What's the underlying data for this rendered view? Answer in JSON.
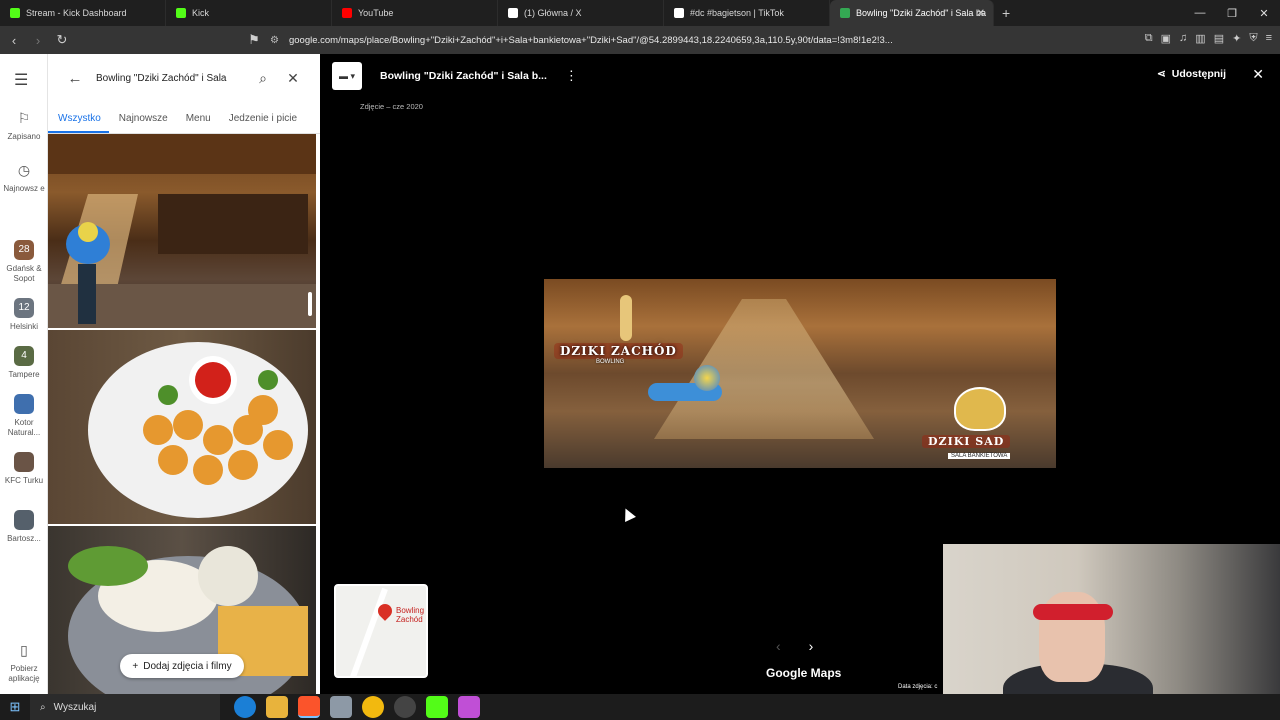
{
  "browser": {
    "tabs": [
      {
        "label": "Stream - Kick Dashboard",
        "color": "#53fc18"
      },
      {
        "label": "Kick",
        "color": "#53fc18"
      },
      {
        "label": "YouTube",
        "color": "#ff0000"
      },
      {
        "label": "(1) Główna / X",
        "color": "#ffffff"
      },
      {
        "label": "#dc #bagietson | TikTok",
        "color": "#ffffff"
      },
      {
        "label": "Bowling \"Dziki Zachód\" i Sala ba",
        "color": "#34a853"
      }
    ],
    "url": "google.com/maps/place/Bowling+\"Dziki+Zachód\"+i+Sala+bankietowa+\"Dziki+Sad\"/@54.2899443,18.2240659,3a,110.5y,90t/data=!3m8!1e2!3...",
    "new_tab": "+",
    "win_minimize": "—",
    "win_restore": "❐",
    "win_close": "✕"
  },
  "rail": {
    "menu_icon": "☰",
    "saved": "Zapisano",
    "recent": "Najnowsz e",
    "items": [
      {
        "label": "Gdańsk & Sopot",
        "badge": "28",
        "color": "#8a5a3c"
      },
      {
        "label": "Helsinki",
        "badge": "12",
        "color": "#6c7580"
      },
      {
        "label": "Tampere",
        "badge": "4",
        "color": "#5a6b44"
      },
      {
        "label": "Kotor Natural...",
        "badge": "",
        "color": "#3f6fae"
      },
      {
        "label": "KFC Turku",
        "badge": "",
        "color": "#6a5446"
      },
      {
        "label": "Bartosz...",
        "badge": "",
        "color": "#55606b"
      }
    ],
    "get_app": "Pobierz aplikację"
  },
  "panel": {
    "search_value": "Bowling \"Dziki Zachód\" i Sala",
    "tabs": [
      "Wszystko",
      "Najnowsze",
      "Menu",
      "Jedzenie i picie"
    ],
    "add_photos": "Dodaj zdjęcia i filmy"
  },
  "viewer": {
    "title": "Bowling \"Dziki Zachód\" i Sala b...",
    "subtitle": "Zdjęcie – cze 2020",
    "share": "Udostępnij",
    "brand": "Google Maps",
    "copyright": "Data zdjęcia: c",
    "banner": {
      "logo_left": "DZIKI ZACHÓD",
      "logo_left_sub": "BOWLING",
      "logo_right": "DZIKI SAD",
      "logo_right_sub": "SALA BANKIETOWA"
    },
    "minimap_label": "Bowling Zachód"
  },
  "taskbar": {
    "search": "Wyszukaj"
  }
}
